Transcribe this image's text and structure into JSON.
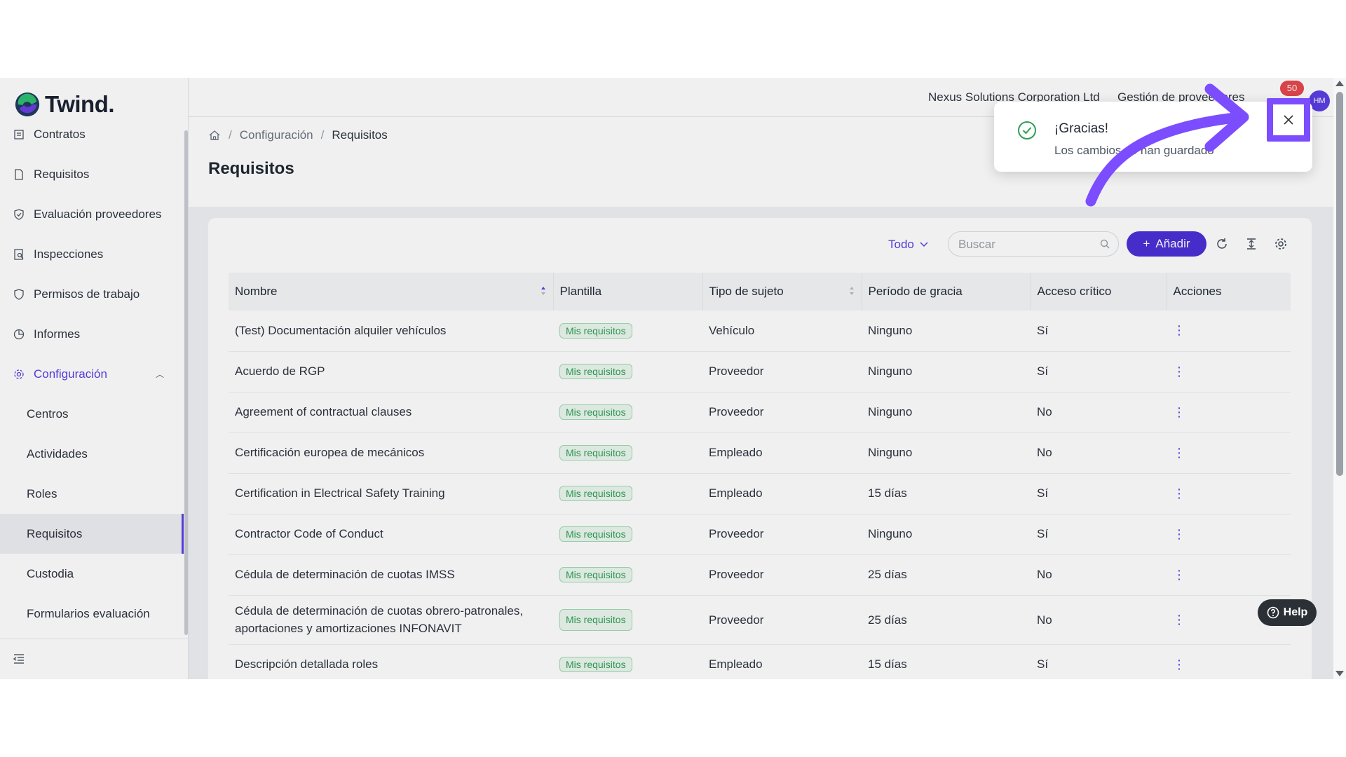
{
  "app": {
    "logo_text": "Twind."
  },
  "sidebar": {
    "items": [
      {
        "label": "Contratos",
        "icon": "contract-icon"
      },
      {
        "label": "Requisitos",
        "icon": "document-icon"
      },
      {
        "label": "Evaluación proveedores",
        "icon": "shield-icon"
      },
      {
        "label": "Inspecciones",
        "icon": "inspection-icon"
      },
      {
        "label": "Permisos de trabajo",
        "icon": "shield-icon"
      },
      {
        "label": "Informes",
        "icon": "pie-chart-icon"
      }
    ],
    "group": {
      "label": "Configuración",
      "icon": "gear-icon",
      "expanded": true
    },
    "sub_items": [
      {
        "label": "Centros"
      },
      {
        "label": "Actividades"
      },
      {
        "label": "Roles"
      },
      {
        "label": "Requisitos",
        "selected": true
      },
      {
        "label": "Custodia"
      },
      {
        "label": "Formularios evaluación"
      }
    ]
  },
  "topbar": {
    "company": "Nexus Solutions Corporation Ltd",
    "role": "Gestión de proveedores",
    "notification_count": "50",
    "avatar_initials": "HM"
  },
  "breadcrumb": {
    "level1": "Configuración",
    "level2": "Requisitos"
  },
  "page": {
    "title": "Requisitos"
  },
  "toolbar": {
    "filter": "Todo",
    "search_placeholder": "Buscar",
    "add_label": "Añadir"
  },
  "table": {
    "headers": {
      "name": "Nombre",
      "template": "Plantilla",
      "subject_type": "Tipo de sujeto",
      "grace": "Período de gracia",
      "critical": "Acceso crítico",
      "actions": "Acciones"
    },
    "rows": [
      {
        "name": "(Test) Documentación alquiler vehículos",
        "template": "Mis requisitos",
        "subject_type": "Vehículo",
        "grace": "Ninguno",
        "critical": "Sí"
      },
      {
        "name": "Acuerdo de RGP",
        "template": "Mis requisitos",
        "subject_type": "Proveedor",
        "grace": "Ninguno",
        "critical": "Sí"
      },
      {
        "name": "Agreement of contractual clauses",
        "template": "Mis requisitos",
        "subject_type": "Proveedor",
        "grace": "Ninguno",
        "critical": "No"
      },
      {
        "name": "Certificación europea de mecánicos",
        "template": "Mis requisitos",
        "subject_type": "Empleado",
        "grace": "Ninguno",
        "critical": "No"
      },
      {
        "name": "Certification in Electrical Safety Training",
        "template": "Mis requisitos",
        "subject_type": "Empleado",
        "grace": "15 días",
        "critical": "Sí"
      },
      {
        "name": "Contractor Code of Conduct",
        "template": "Mis requisitos",
        "subject_type": "Proveedor",
        "grace": "Ninguno",
        "critical": "Sí"
      },
      {
        "name": "Cédula de determinación de cuotas IMSS",
        "template": "Mis requisitos",
        "subject_type": "Proveedor",
        "grace": "25 días",
        "critical": "No"
      },
      {
        "name": "Cédula de determinación de cuotas obrero-patronales, aportaciones y amortizaciones INFONAVIT",
        "template": "Mis requisitos",
        "subject_type": "Proveedor",
        "grace": "25 días",
        "critical": "No"
      },
      {
        "name": "Descripción detallada roles",
        "template": "Mis requisitos",
        "subject_type": "Empleado",
        "grace": "15 días",
        "critical": "Sí"
      }
    ]
  },
  "toast": {
    "title": "¡Gracias!",
    "message": "Los cambios se han guardado"
  },
  "help": {
    "label": "Help"
  },
  "colors": {
    "accent": "#5b3ee6",
    "primary_button": "#4b2fd6",
    "success": "#2f9e55",
    "highlight": "#7c4dff"
  }
}
